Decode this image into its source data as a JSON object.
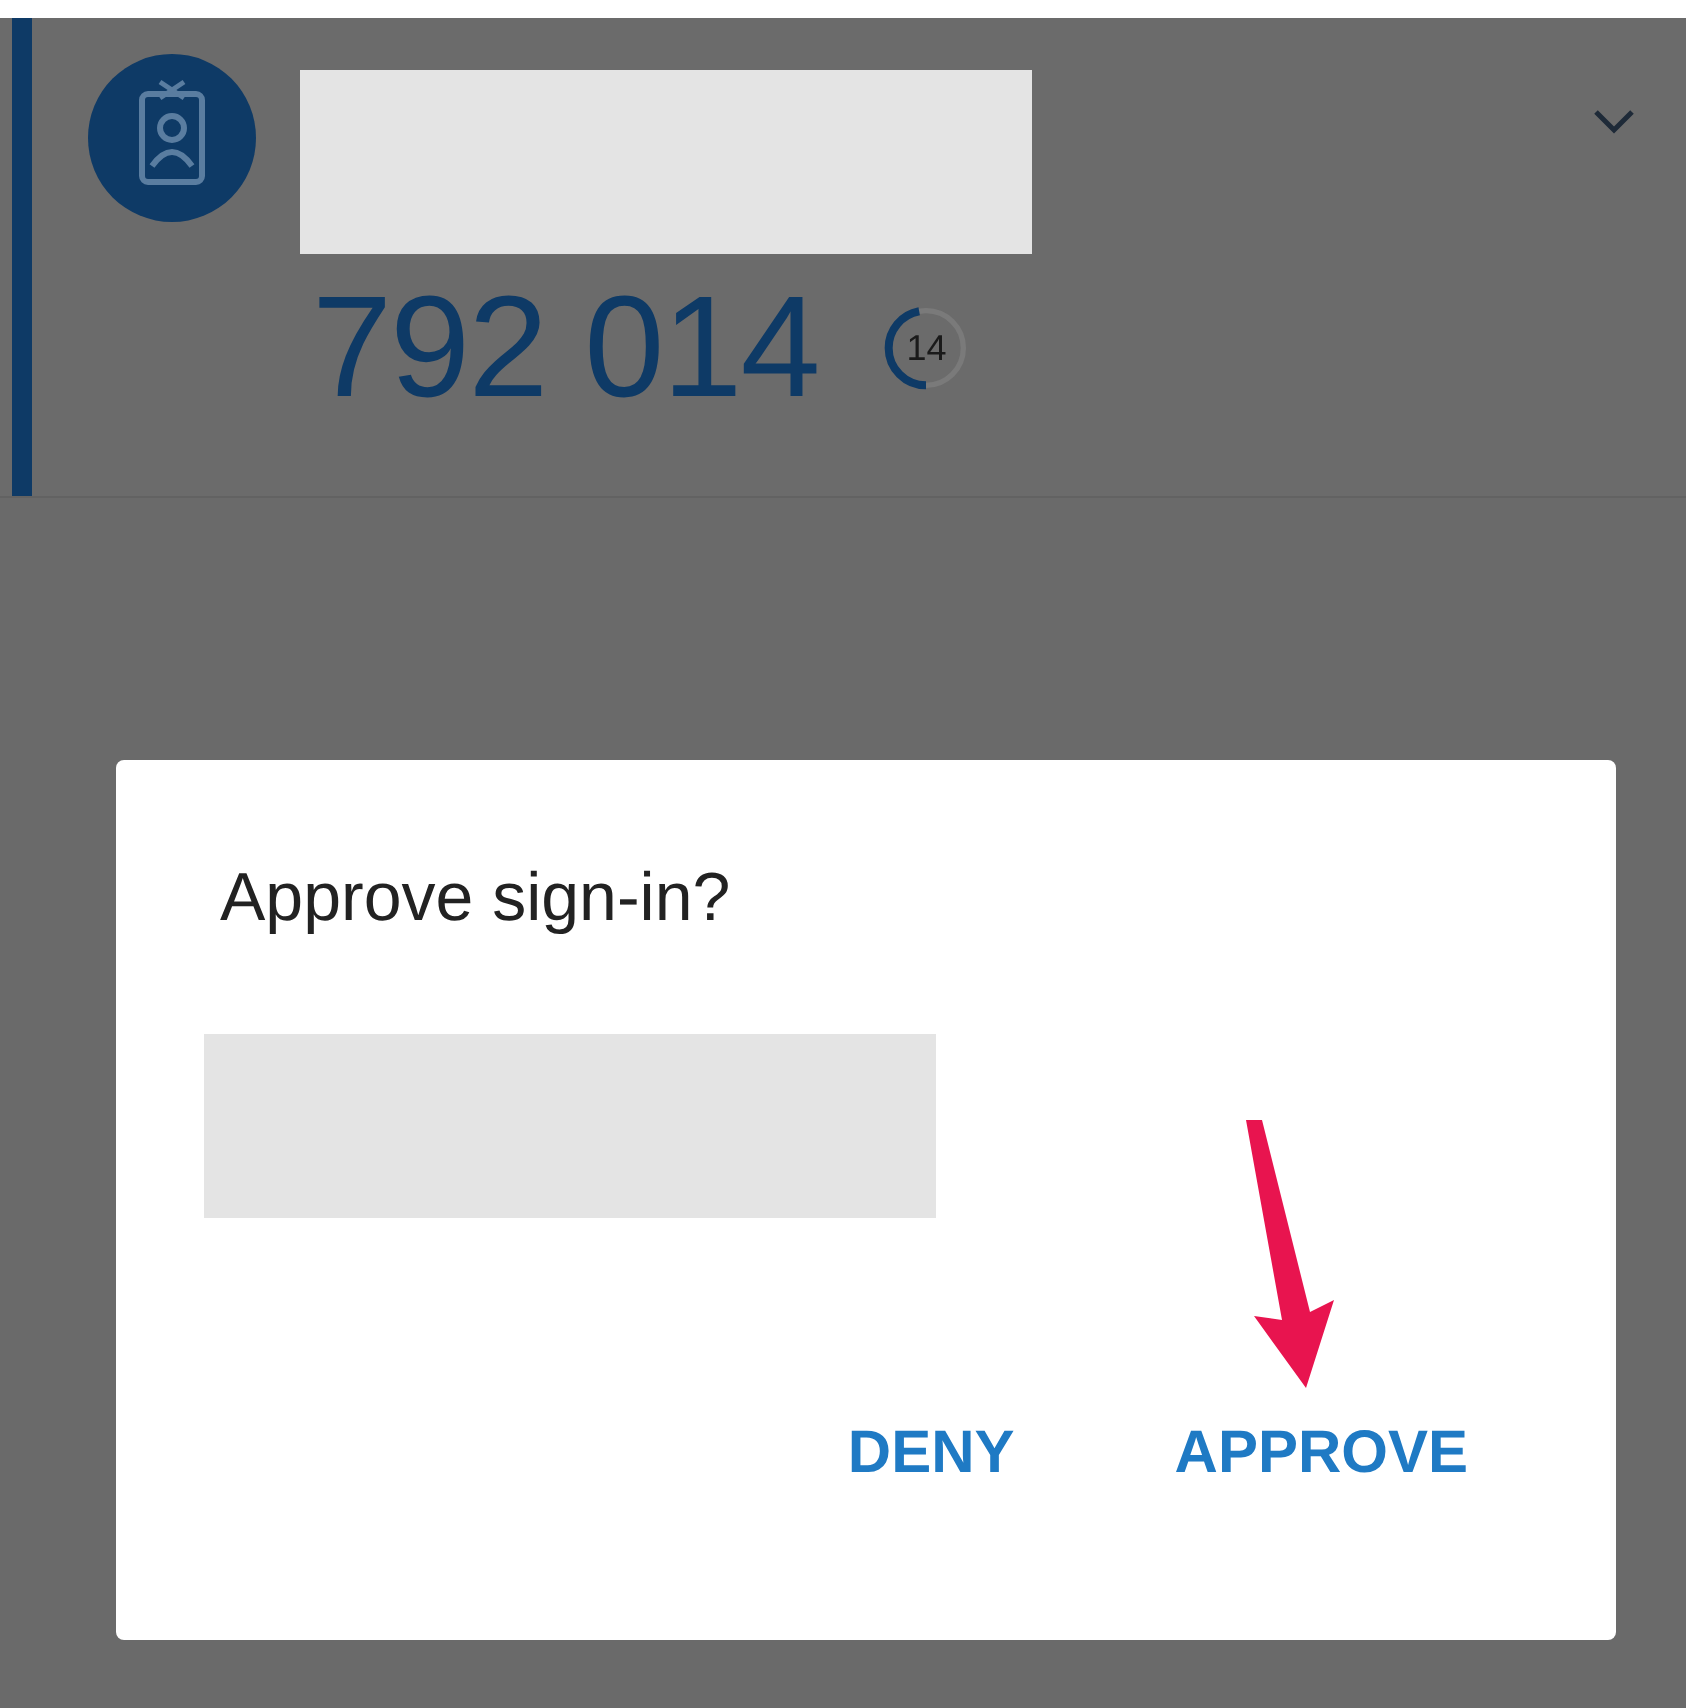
{
  "account": {
    "code": "792 014",
    "timer": {
      "seconds": "14",
      "level": 0.47
    },
    "expanded": false
  },
  "dialog": {
    "title": "Approve sign-in?",
    "buttons": [
      {
        "label": "DENY"
      },
      {
        "label": "APPROVE"
      }
    ]
  }
}
